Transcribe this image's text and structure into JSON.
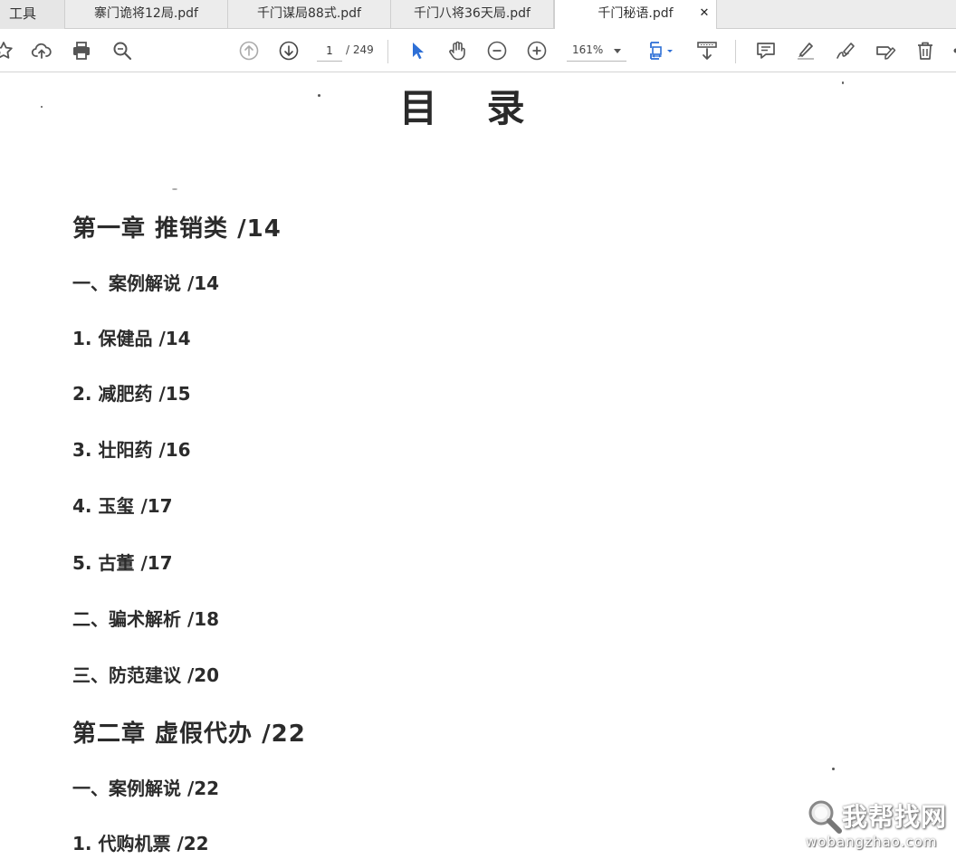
{
  "tabs": {
    "tools_label": "工具",
    "items": [
      {
        "label": "寨门诡将12局.pdf"
      },
      {
        "label": "千门谋局88式.pdf"
      },
      {
        "label": "千门八将36天局.pdf"
      },
      {
        "label": "千门秘语.pdf",
        "active": true
      }
    ],
    "close_glyph": "✕"
  },
  "toolbar": {
    "current_page": "1",
    "total_pages": "/ 249",
    "zoom": "161%",
    "icons": [
      "star-icon",
      "cloud-upload-icon",
      "print-icon",
      "search-icon",
      "page-up-icon",
      "page-down-icon",
      "select-cursor-icon",
      "hand-icon",
      "zoom-out-icon",
      "zoom-in-icon",
      "fit-page-icon",
      "scroll-mode-icon",
      "comment-icon",
      "highlight-icon",
      "sign-icon",
      "fill-sign-icon",
      "delete-icon"
    ],
    "accent_color": "#2d6fd6"
  },
  "document": {
    "title": "目 录",
    "toc": [
      {
        "text": "第一章  推销类  /14",
        "level": "chapter"
      },
      {
        "text": "一、案例解说  /14",
        "level": "section"
      },
      {
        "text": "1. 保健品  /14",
        "level": "item"
      },
      {
        "text": "2. 减肥药  /15",
        "level": "item"
      },
      {
        "text": "3. 壮阳药  /16",
        "level": "item"
      },
      {
        "text": "4. 玉玺  /17",
        "level": "item"
      },
      {
        "text": "5. 古董  /17",
        "level": "item"
      },
      {
        "text": "二、骗术解析  /18",
        "level": "section"
      },
      {
        "text": "三、防范建议  /20",
        "level": "section"
      },
      {
        "text": "第二章  虚假代办  /22",
        "level": "chapter"
      },
      {
        "text": "一、案例解说  /22",
        "level": "section"
      },
      {
        "text": "1. 代购机票  /22",
        "level": "item"
      }
    ]
  },
  "watermark": {
    "cn": "我帮找网",
    "en": "wobangzhao.com"
  }
}
